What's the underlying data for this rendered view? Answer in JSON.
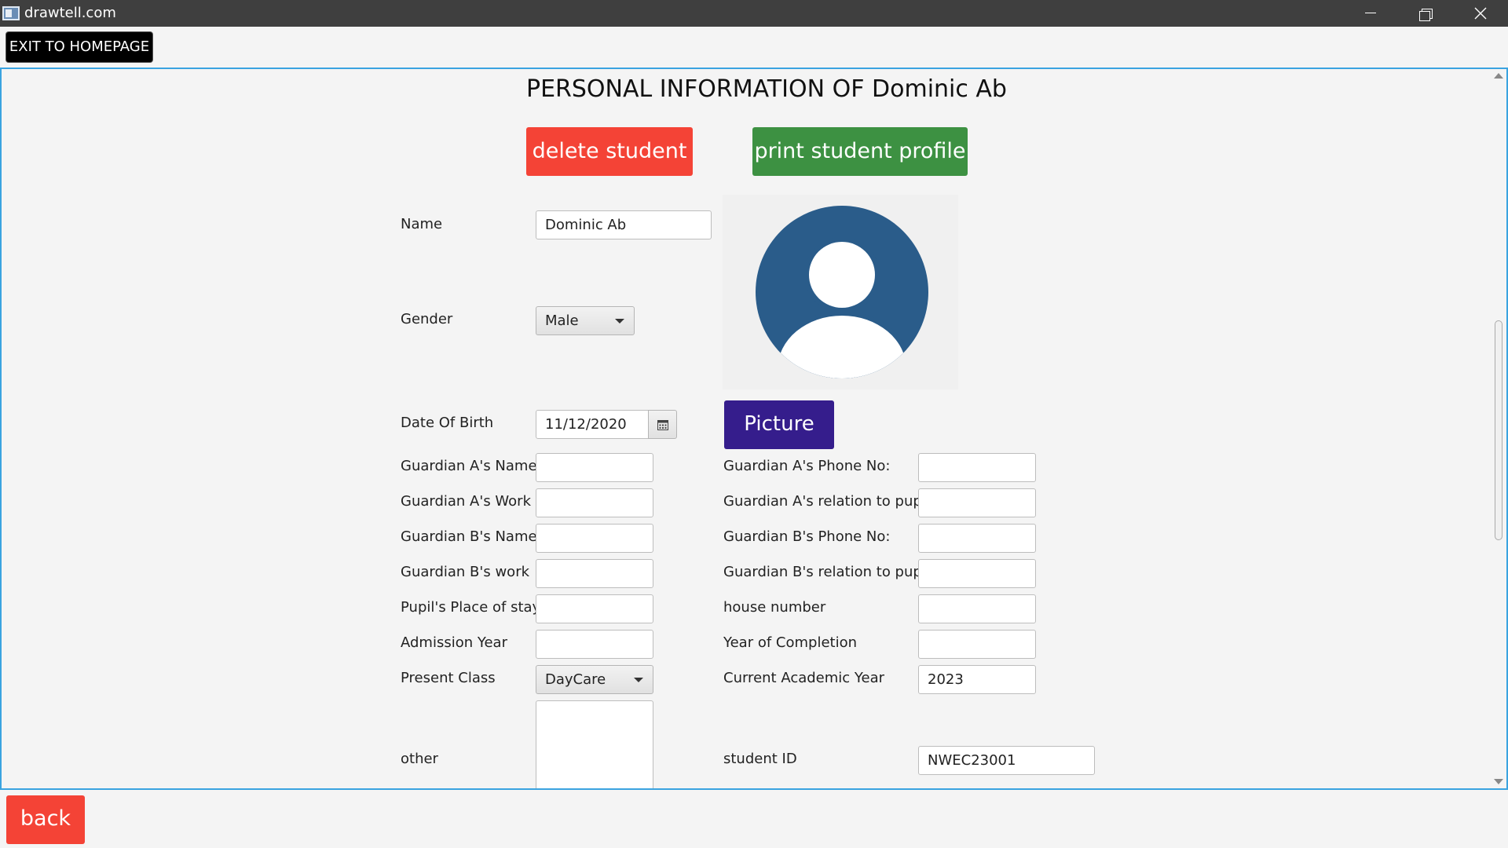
{
  "window": {
    "title": "drawtell.com"
  },
  "toolbar": {
    "exit_label": "EXIT TO HOMEPAGE"
  },
  "page": {
    "title": "PERSONAL INFORMATION OF Dominic Ab",
    "delete_label": "delete student",
    "print_label": "print student profile",
    "picture_label": "Picture",
    "back_label": "back"
  },
  "form": {
    "name": {
      "label": "Name",
      "value": "Dominic Ab"
    },
    "gender": {
      "label": "Gender",
      "value": "Male"
    },
    "dob": {
      "label": "Date Of Birth",
      "value": "11/12/2020"
    },
    "guardian_a_name": {
      "label": "Guardian A's Name",
      "value": ""
    },
    "guardian_a_work": {
      "label": "Guardian A's Work",
      "value": ""
    },
    "guardian_b_name": {
      "label": "Guardian B's Name",
      "value": ""
    },
    "guardian_b_work": {
      "label": "Guardian B's work",
      "value": ""
    },
    "place_of_stay": {
      "label": "Pupil's Place of stay",
      "value": ""
    },
    "admission_year": {
      "label": "Admission Year",
      "value": ""
    },
    "present_class": {
      "label": "Present Class",
      "value": "DayCare"
    },
    "other": {
      "label": "other",
      "value": ""
    },
    "guardian_a_phone": {
      "label": "Guardian A's Phone No:",
      "value": ""
    },
    "guardian_a_relation": {
      "label": "Guardian A's relation to pupil",
      "value": ""
    },
    "guardian_b_phone": {
      "label": "Guardian B's Phone No:",
      "value": ""
    },
    "guardian_b_relation": {
      "label": "Guardian B's relation to pupil",
      "value": ""
    },
    "house_number": {
      "label": "house number",
      "value": ""
    },
    "year_of_completion": {
      "label": "Year of Completion",
      "value": ""
    },
    "current_academic_year": {
      "label": "Current Academic Year",
      "value": "2023"
    },
    "student_id": {
      "label": "student ID",
      "value": "NWEC23001"
    }
  },
  "colors": {
    "delete": "#f44336",
    "print": "#3d9142",
    "picture": "#351d8c",
    "avatar": "#2a5c8a",
    "pane_border": "#3aa3e0"
  },
  "icons": {
    "avatar": "user-avatar-icon",
    "calendar": "calendar-icon"
  }
}
